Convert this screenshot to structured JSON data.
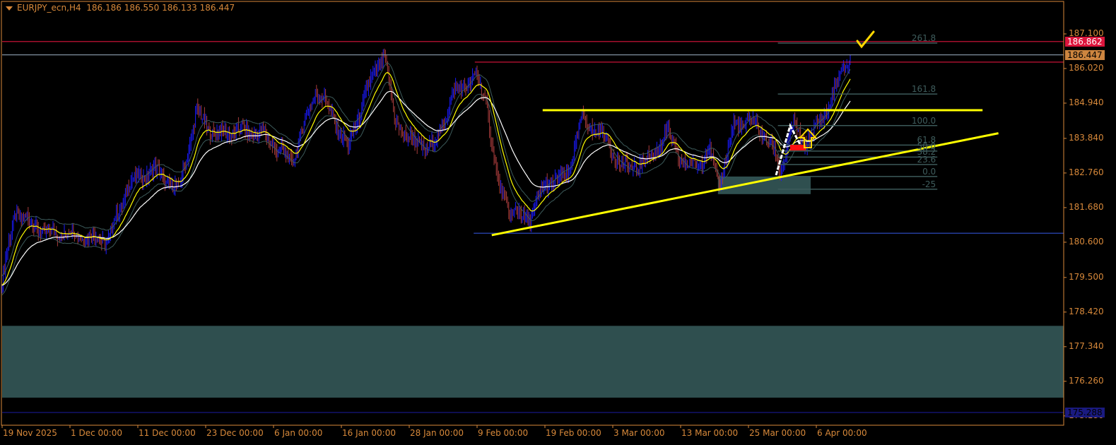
{
  "header": {
    "symbol": "EURJPY_ecn,H4",
    "ohlc": "186.186 186.550 186.133 186.447"
  },
  "chart_data": {
    "type": "ohlc-bar",
    "symbol": "EURJPY_ecn",
    "timeframe": "H4",
    "ylim": [
      175.18,
      187.1
    ],
    "y_ticks": [
      "187.100",
      "186.020",
      "184.940",
      "183.840",
      "182.760",
      "181.680",
      "180.600",
      "179.500",
      "178.420",
      "177.340",
      "176.260",
      "175.180"
    ],
    "x_ticks": [
      "19 Nov 2025",
      "1 Dec 00:00",
      "11 Dec 00:00",
      "23 Dec 00:00",
      "6 Jan 00:00",
      "16 Jan 00:00",
      "28 Jan 00:00",
      "9 Feb 00:00",
      "19 Feb 00:00",
      "3 Mar 00:00",
      "13 Mar 00:00",
      "25 Mar 00:00",
      "6 Apr 00:00"
    ],
    "total_bars": 780,
    "bars_per_tick": 60,
    "price_path": [
      [
        2,
        179.78
      ],
      [
        12,
        181.55
      ],
      [
        38,
        180.88
      ],
      [
        62,
        180.88
      ],
      [
        94,
        180.66
      ],
      [
        112,
        182.43
      ],
      [
        134,
        182.87
      ],
      [
        156,
        182.21
      ],
      [
        172,
        184.63
      ],
      [
        188,
        183.97
      ],
      [
        212,
        184.08
      ],
      [
        231,
        183.97
      ],
      [
        256,
        183.09
      ],
      [
        278,
        185.4
      ],
      [
        291,
        184.63
      ],
      [
        306,
        183.53
      ],
      [
        322,
        185.29
      ],
      [
        338,
        186.5
      ],
      [
        347,
        184.41
      ],
      [
        362,
        183.75
      ],
      [
        381,
        183.53
      ],
      [
        400,
        185.29
      ],
      [
        419,
        185.73
      ],
      [
        428,
        185.07
      ],
      [
        438,
        182.43
      ],
      [
        450,
        181.55
      ],
      [
        466,
        181.33
      ],
      [
        481,
        182.43
      ],
      [
        500,
        182.65
      ],
      [
        512,
        184.41
      ],
      [
        531,
        183.97
      ],
      [
        550,
        182.87
      ],
      [
        569,
        183.09
      ],
      [
        588,
        183.97
      ],
      [
        606,
        182.87
      ],
      [
        625,
        183.42
      ],
      [
        634,
        182.43
      ],
      [
        647,
        184.19
      ],
      [
        662,
        184.41
      ],
      [
        681,
        183.64
      ],
      [
        688,
        182.76
      ],
      [
        699,
        184.24
      ],
      [
        709,
        183.64
      ],
      [
        725,
        184.41
      ],
      [
        734,
        185.18
      ],
      [
        744,
        185.95
      ],
      [
        750,
        186.447
      ]
    ],
    "current_price_tag": "186.447",
    "level_tags": [
      {
        "price": "186.862",
        "color": "#dc143c"
      },
      {
        "price": "175.288",
        "color": "#1a1a80"
      }
    ],
    "horizontal_lines": [
      {
        "price": 186.862,
        "color": "#dc143c"
      },
      {
        "price": 186.447,
        "color": "#8090a0"
      },
      {
        "price": 186.22,
        "color": "#dc143c",
        "from_bar": 418
      },
      {
        "price": 184.72,
        "color": "#ffff00",
        "from_bar": 478,
        "to_bar": 867
      },
      {
        "price": 180.88,
        "color": "#3050d0",
        "from_bar": 417
      },
      {
        "price": 175.288,
        "color": "#1a1a90"
      }
    ],
    "zones": [
      {
        "top": 177.99,
        "bottom": 175.75,
        "color": "#2f4f4f"
      },
      {
        "top": 182.65,
        "bottom": 182.1,
        "from_bar": 633,
        "to_bar": 715,
        "color": "#2f4f4f"
      }
    ],
    "trendline": {
      "from": [
        433,
        180.82
      ],
      "to": [
        881,
        184.0
      ],
      "color": "#ffff00"
    },
    "fibonacci": {
      "from_bar": 686,
      "to_bar": 827,
      "zero_price": 182.65,
      "hundred_price": 184.24,
      "levels": [
        "261.8",
        "161.8",
        "100.0",
        "61.8",
        "50.0",
        "38.2",
        "23.6",
        "0.0",
        "-25"
      ]
    },
    "colors": {
      "up": "#1a1aff",
      "down": "#a83c3c",
      "ma_fast": "#ffff00",
      "envelope": "#3c5a5a",
      "ma_slow": "#ffffff",
      "axis": "#d8893a"
    }
  }
}
